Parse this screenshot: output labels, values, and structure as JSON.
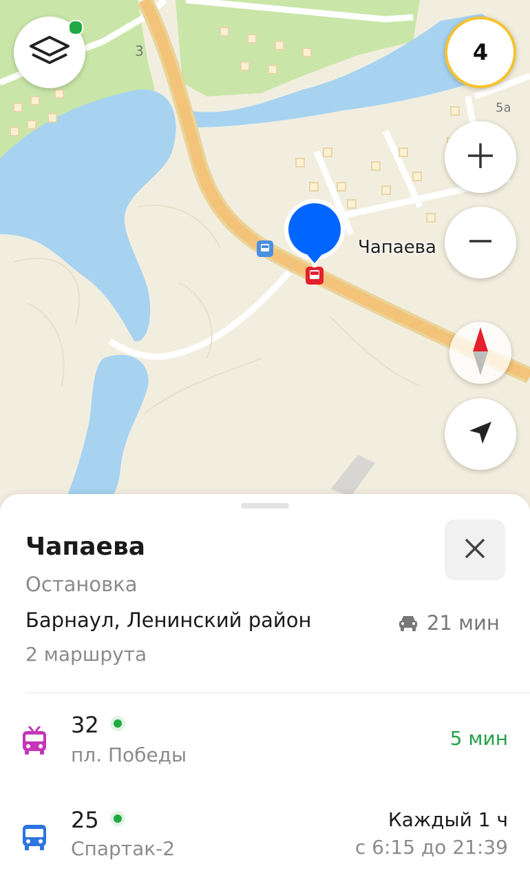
{
  "map": {
    "stop_label": "Чапаева",
    "house_numbers": [
      "3",
      "5а"
    ]
  },
  "controls": {
    "layers_icon": "layers-icon",
    "badge_value": "4",
    "zoom_in_icon": "plus-icon",
    "zoom_out_icon": "minus-icon",
    "compass_icon": "compass-icon",
    "locate_icon": "navigation-arrow-icon"
  },
  "colors": {
    "water": "#a7d3f1",
    "park": "#c9e6a8",
    "road": "#f3c37a",
    "pin": "#0066ff",
    "stop_marker": "#e3202b",
    "arrival_green": "#22a146",
    "trolleybus": "#c436b8",
    "bus": "#2e74e0",
    "badge_ring": "#f7c22d"
  },
  "sheet": {
    "title": "Чапаева",
    "subtitle": "Остановка",
    "address": "Барнаул, Ленинский район",
    "drive_time": "21 мин",
    "route_count": "2 маршрута",
    "routes": [
      {
        "icon": "trolleybus-icon",
        "number": "32",
        "destination": "пл. Победы",
        "eta": "5 мин"
      },
      {
        "icon": "bus-icon",
        "number": "25",
        "destination": "Спартак-2",
        "schedule_line1": "Каждый 1 ч",
        "schedule_line2": "с 6:15 до 21:39"
      }
    ]
  }
}
